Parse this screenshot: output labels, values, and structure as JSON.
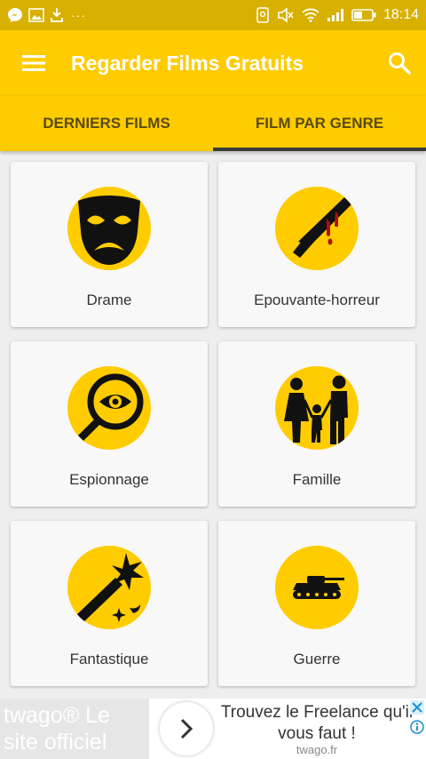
{
  "status_bar": {
    "time": "18:14",
    "dots": "···",
    "left_icons": [
      "messenger-icon",
      "image-icon",
      "download-icon"
    ],
    "right_icons": [
      "nfc-icon",
      "mute-icon",
      "wifi-icon",
      "signal-icon",
      "battery-icon"
    ]
  },
  "app_bar": {
    "title": "Regarder Films Gratuits",
    "menu_icon": "hamburger-menu-icon",
    "search_icon": "search-icon"
  },
  "tabs": [
    {
      "label": "DERNIERS FILMS",
      "active": false
    },
    {
      "label": "FILM PAR GENRE",
      "active": true
    }
  ],
  "genres": [
    {
      "label": "Drame",
      "icon": "tragedy-mask-icon"
    },
    {
      "label": "Epouvante-horreur",
      "icon": "bloody-knife-icon"
    },
    {
      "label": "Espionnage",
      "icon": "magnifier-eye-icon"
    },
    {
      "label": "Famille",
      "icon": "family-icon"
    },
    {
      "label": "Fantastique",
      "icon": "magic-wand-icon"
    },
    {
      "label": "Guerre",
      "icon": "tank-icon"
    }
  ],
  "ad": {
    "left_text": "twago® Le site officiel",
    "headline": "Trouvez le Freelance qu'il vous faut !",
    "domain": "twago.fr"
  },
  "colors": {
    "status_bar": "#d8b000",
    "primary": "#ffcc00",
    "tab_text": "#5a4a10",
    "tab_indicator": "#3a3a3a",
    "background": "#eeeeee",
    "card": "#f8f8f8"
  }
}
